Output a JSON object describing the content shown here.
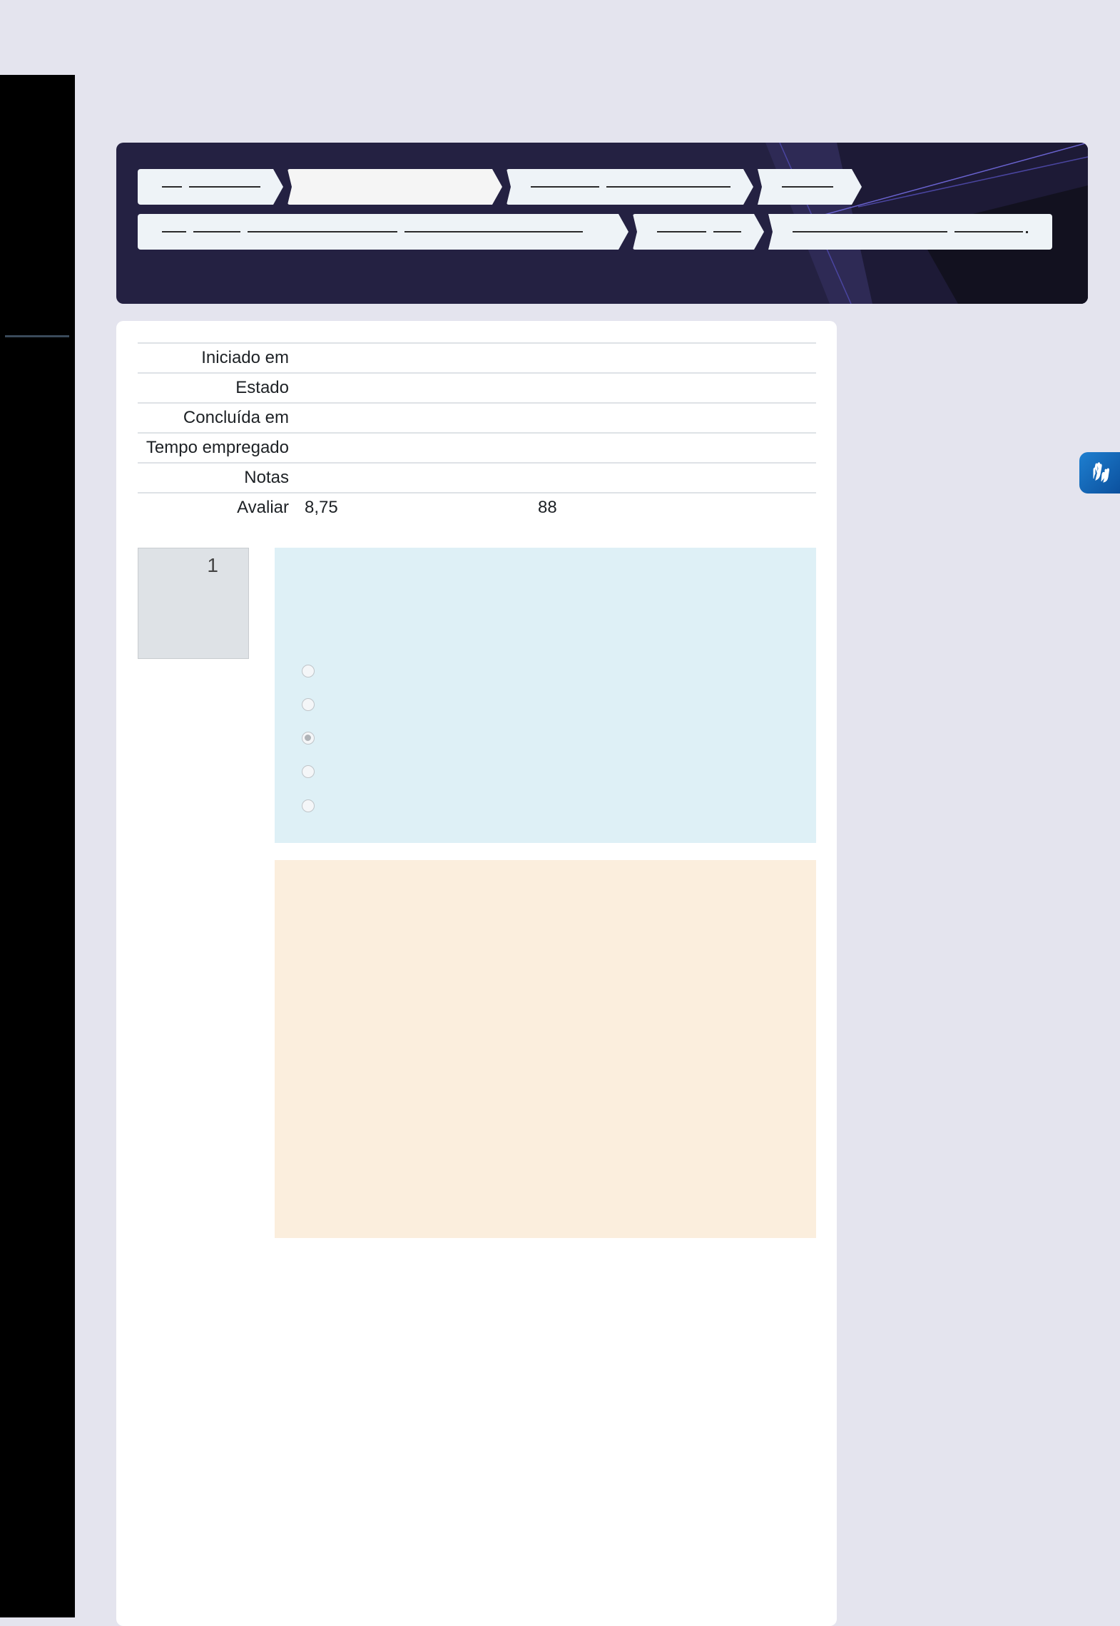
{
  "summary": {
    "rows": [
      {
        "label": "Iniciado em",
        "value": ""
      },
      {
        "label": "Estado",
        "value": ""
      },
      {
        "label": "Concluída em",
        "value": ""
      },
      {
        "label": "Tempo empregado",
        "value": ""
      },
      {
        "label": "Notas",
        "value": ""
      },
      {
        "label": "Avaliar",
        "value_a": "8,75",
        "value_b": "88"
      }
    ]
  },
  "question": {
    "number": "1",
    "options_selected_index": 2,
    "options_count": 5
  },
  "colors": {
    "background": "#e4e4ee",
    "sidebar": "#000000",
    "hero": "#242142",
    "formulation": "#def0f6",
    "outcome": "#fbeedd",
    "accessibility_button": "#1e7fd0"
  },
  "icons": {
    "accessibility": "sign-language-hands-icon"
  }
}
